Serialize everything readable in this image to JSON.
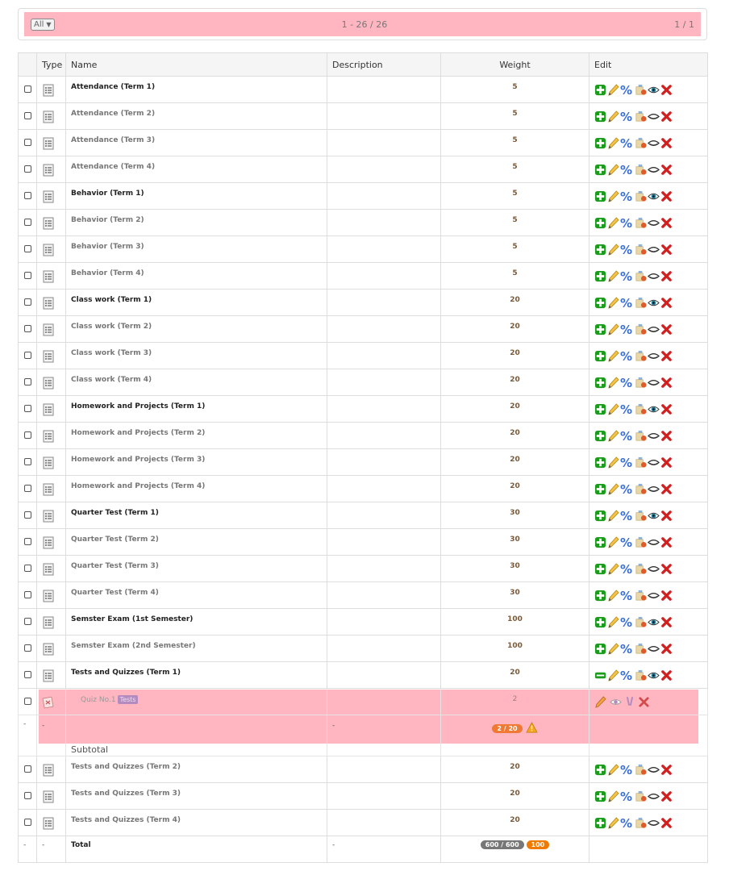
{
  "pager": {
    "filter_value": "All",
    "range_text": "1 - 26 / 26",
    "page_text": "1 / 1"
  },
  "columns": {
    "type": "Type",
    "name": "Name",
    "description": "Description",
    "weight": "Weight",
    "edit": "Edit"
  },
  "rows": [
    {
      "name": "Attendance (Term 1)",
      "weight": "5",
      "bold": true,
      "visible": true
    },
    {
      "name": "Attendance (Term 2)",
      "weight": "5",
      "bold": false,
      "visible": false
    },
    {
      "name": "Attendance (Term 3)",
      "weight": "5",
      "bold": false,
      "visible": false
    },
    {
      "name": "Attendance (Term 4)",
      "weight": "5",
      "bold": false,
      "visible": false
    },
    {
      "name": "Behavior (Term 1)",
      "weight": "5",
      "bold": true,
      "visible": true
    },
    {
      "name": "Behavior (Term 2)",
      "weight": "5",
      "bold": false,
      "visible": false
    },
    {
      "name": "Behavior (Term 3)",
      "weight": "5",
      "bold": false,
      "visible": false
    },
    {
      "name": "Behavior (Term 4)",
      "weight": "5",
      "bold": false,
      "visible": false
    },
    {
      "name": "Class work (Term 1)",
      "weight": "20",
      "bold": true,
      "visible": true
    },
    {
      "name": "Class work (Term 2)",
      "weight": "20",
      "bold": false,
      "visible": false
    },
    {
      "name": "Class work (Term 3)",
      "weight": "20",
      "bold": false,
      "visible": false
    },
    {
      "name": "Class work (Term 4)",
      "weight": "20",
      "bold": false,
      "visible": false
    },
    {
      "name": "Homework and Projects (Term 1)",
      "weight": "20",
      "bold": true,
      "visible": true
    },
    {
      "name": "Homework and Projects (Term 2)",
      "weight": "20",
      "bold": false,
      "visible": false
    },
    {
      "name": "Homework and Projects (Term 3)",
      "weight": "20",
      "bold": false,
      "visible": false
    },
    {
      "name": "Homework and Projects (Term 4)",
      "weight": "20",
      "bold": false,
      "visible": false
    },
    {
      "name": "Quarter Test (Term 1)",
      "weight": "30",
      "bold": true,
      "visible": true
    },
    {
      "name": "Quarter Test (Term 2)",
      "weight": "30",
      "bold": false,
      "visible": false
    },
    {
      "name": "Quarter Test (Term 3)",
      "weight": "30",
      "bold": false,
      "visible": false
    },
    {
      "name": "Quarter Test (Term 4)",
      "weight": "30",
      "bold": false,
      "visible": false
    },
    {
      "name": "Semster Exam (1st Semester)",
      "weight": "100",
      "bold": true,
      "visible": true
    },
    {
      "name": "Semster Exam (2nd Semester)",
      "weight": "100",
      "bold": false,
      "visible": false
    },
    {
      "name": "Tests and Quizzes (Term 1)",
      "weight": "20",
      "bold": true,
      "visible": true,
      "expanded": true
    }
  ],
  "quiz": {
    "name": "Quiz No.1",
    "tag": "Tests",
    "weight": "2"
  },
  "subtotal": {
    "dash": "-",
    "label": "Subtotal",
    "badge": "2 / 20"
  },
  "rows_after": [
    {
      "name": "Tests and Quizzes (Term 2)",
      "weight": "20",
      "bold": false,
      "visible": false
    },
    {
      "name": "Tests and Quizzes (Term 3)",
      "weight": "20",
      "bold": false,
      "visible": false
    },
    {
      "name": "Tests and Quizzes (Term 4)",
      "weight": "20",
      "bold": false,
      "visible": false
    }
  ],
  "total": {
    "dash": "-",
    "label": "Total",
    "badge": "600 / 600",
    "percent_badge": "100"
  },
  "colors": {
    "highlight": "#ffb6c1",
    "add_green": "#1c9c1c",
    "delete_red": "#d21f1f",
    "percent_blue": "#3a6fd8",
    "eye_teal": "#1a7d9c"
  },
  "icons": [
    "grade-item-icon",
    "add-icon",
    "collapse-icon",
    "edit-pencil-icon",
    "percent-icon",
    "rubric-icon",
    "visible-eye-icon",
    "hidden-eye-icon",
    "delete-icon",
    "quiz-icon",
    "warning-icon",
    "lock-icon"
  ]
}
